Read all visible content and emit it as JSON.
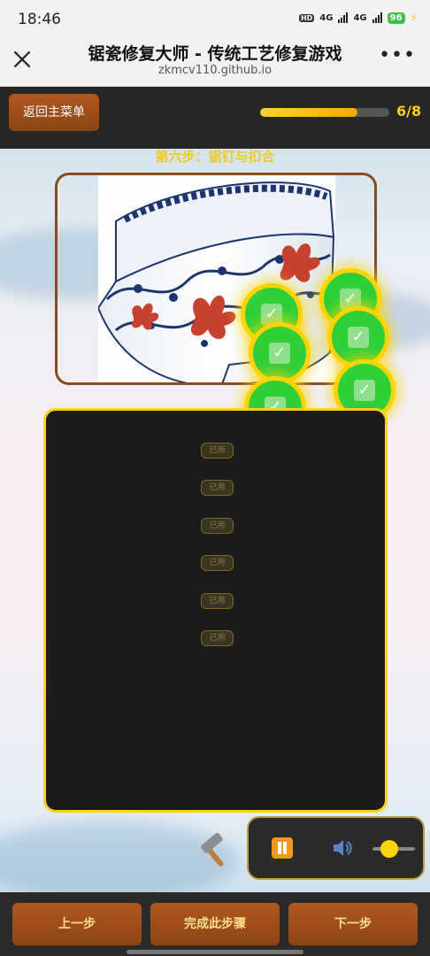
{
  "status_bar": {
    "time": "18:46",
    "hd_label": "HD",
    "network_1": "4G",
    "network_2": "4G",
    "battery": "96",
    "icons": [
      "hd-icon",
      "signal-icon",
      "signal-icon",
      "battery-icon",
      "charging-bolt-icon"
    ]
  },
  "browser": {
    "title": "锯瓷修复大师 - 传统工艺修复游戏",
    "url": "zkmcv110.github.io",
    "close_icon": "close-icon",
    "more_icon": "more-icon"
  },
  "header": {
    "menu_button": "返回主菜单",
    "progress_label": "6/8",
    "progress_fraction": 0.75
  },
  "step": {
    "title": "第六步：锯钉与扣合"
  },
  "workspace": {
    "image": "blue-and-white-porcelain-bowl",
    "check_badges": [
      {
        "icon": "check-icon",
        "glyph": "✓"
      },
      {
        "icon": "check-icon",
        "glyph": "✓"
      },
      {
        "icon": "check-icon",
        "glyph": "✓"
      },
      {
        "icon": "check-icon",
        "glyph": "✓"
      },
      {
        "icon": "check-icon",
        "glyph": "✓"
      },
      {
        "icon": "check-icon",
        "glyph": "✓"
      }
    ]
  },
  "pieces_panel": {
    "items": [
      "已用",
      "已用",
      "已用",
      "已用",
      "已用",
      "已用"
    ]
  },
  "tool": {
    "icon": "hammer-icon"
  },
  "audio_controls": {
    "pause_icon": "pause-icon",
    "speaker_icon": "speaker-icon",
    "volume_fraction": 0.4
  },
  "bottom_nav": {
    "prev_label": "上一步",
    "complete_label": "完成此步骤",
    "next_label": "下一步"
  },
  "colors": {
    "accent_gold": "#ffd400",
    "button_brown": "#9b4c18",
    "success_green": "#2fcf3a",
    "panel_dark": "#1b1b1b"
  }
}
